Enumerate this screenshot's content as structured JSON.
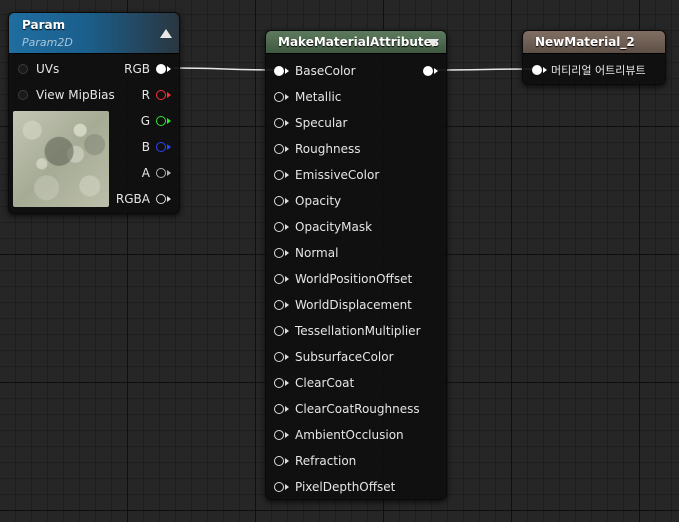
{
  "param_node": {
    "title": "Param",
    "subtitle": "Param2D",
    "header_color": "#1f6ea0",
    "inputs": [
      {
        "label": "UVs"
      },
      {
        "label": "View MipBias"
      }
    ],
    "outputs": [
      {
        "label": "RGB",
        "pin_color": "#ffffff"
      },
      {
        "label": "R",
        "pin_color": "#ff3030"
      },
      {
        "label": "G",
        "pin_color": "#2ee82e"
      },
      {
        "label": "B",
        "pin_color": "#2a46ff"
      },
      {
        "label": "A",
        "pin_color": "#b4b4b4"
      },
      {
        "label": "RGBA",
        "pin_color": "#dcdcdc"
      }
    ]
  },
  "make_node": {
    "title": "MakeMaterialAttributes",
    "header_color": "#4f6b50",
    "inputs": [
      {
        "label": "BaseColor"
      },
      {
        "label": "Metallic"
      },
      {
        "label": "Specular"
      },
      {
        "label": "Roughness"
      },
      {
        "label": "EmissiveColor"
      },
      {
        "label": "Opacity"
      },
      {
        "label": "OpacityMask"
      },
      {
        "label": "Normal"
      },
      {
        "label": "WorldPositionOffset"
      },
      {
        "label": "WorldDisplacement"
      },
      {
        "label": "TessellationMultiplier"
      },
      {
        "label": "SubsurfaceColor"
      },
      {
        "label": "ClearCoat"
      },
      {
        "label": "ClearCoatRoughness"
      },
      {
        "label": "AmbientOcclusion"
      },
      {
        "label": "Refraction"
      },
      {
        "label": "PixelDepthOffset"
      }
    ]
  },
  "result_node": {
    "title": "NewMaterial_2",
    "header_color": "#6e5f55",
    "input_label": "머티리얼 어트리뷰트"
  },
  "colors": {
    "wire": "#e8e8e8",
    "background": "#262626"
  }
}
